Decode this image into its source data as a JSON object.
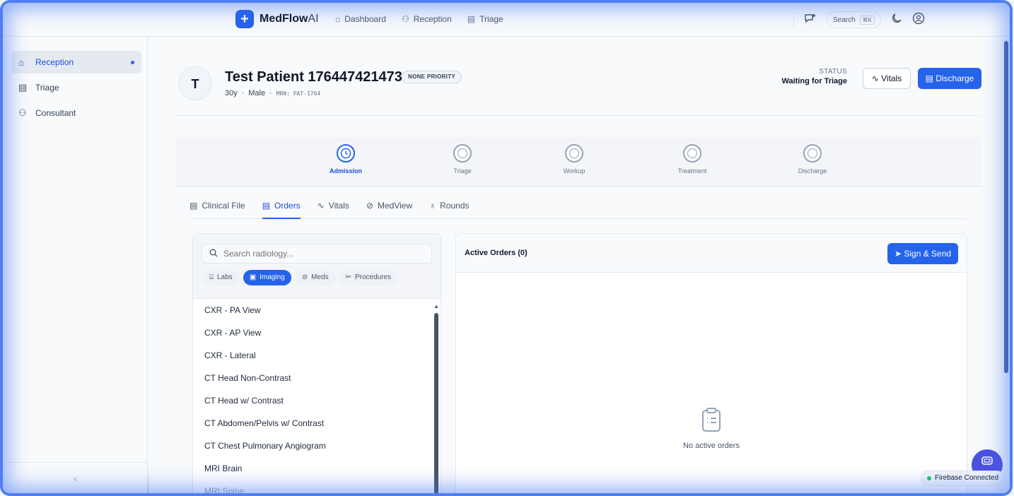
{
  "app": {
    "name_main": "MedFlow",
    "name_suffix": "AI",
    "logo_glyph": "+"
  },
  "topnav": [
    {
      "label": "Dashboard",
      "icon": "home-icon"
    },
    {
      "label": "Reception",
      "icon": "user-plus-icon"
    },
    {
      "label": "Triage",
      "icon": "clipboard-icon"
    }
  ],
  "topright": {
    "search_label": "Search",
    "search_shortcut": "⌘K"
  },
  "sidebar": {
    "items": [
      {
        "label": "Reception",
        "icon": "home-icon",
        "active": true
      },
      {
        "label": "Triage",
        "icon": "clipboard-icon",
        "active": false
      },
      {
        "label": "Consultant",
        "icon": "users-icon",
        "active": false
      }
    ],
    "collapse_glyph": "‹"
  },
  "patient": {
    "initial": "T",
    "name": "Test Patient 1764474214731",
    "priority": "NONE PRIORITY",
    "age": "30y",
    "sex": "Male",
    "mrn": "MRN: PAT-1764",
    "status_label": "STATUS",
    "status_value": "Waiting for Triage",
    "vitals_btn": "Vitals",
    "discharge_btn": "Discharge"
  },
  "stepper": [
    {
      "label": "Admission",
      "active": true
    },
    {
      "label": "Triage",
      "active": false
    },
    {
      "label": "Workup",
      "active": false
    },
    {
      "label": "Treatment",
      "active": false
    },
    {
      "label": "Discharge",
      "active": false
    }
  ],
  "tabs": [
    {
      "label": "Clinical File",
      "active": false
    },
    {
      "label": "Orders",
      "active": true
    },
    {
      "label": "Vitals",
      "active": false
    },
    {
      "label": "MedView",
      "active": false
    },
    {
      "label": "Rounds",
      "active": false
    }
  ],
  "orders": {
    "search_placeholder": "Search radiology...",
    "chips": [
      {
        "label": "Labs",
        "active": false
      },
      {
        "label": "Imaging",
        "active": true
      },
      {
        "label": "Meds",
        "active": false
      },
      {
        "label": "Procedures",
        "active": false
      }
    ],
    "items": [
      "CXR - PA View",
      "CXR - AP View",
      "CXR - Lateral",
      "CT Head Non-Contrast",
      "CT Head w/ Contrast",
      "CT Abdomen/Pelvis w/ Contrast",
      "CT Chest Pulmonary Angiogram",
      "MRI Brain",
      "MRI Spine"
    ],
    "active_title": "Active Orders (0)",
    "sign_btn": "Sign & Send",
    "empty_text": "No active orders"
  },
  "firebase": {
    "label": "Firebase Connected"
  },
  "colors": {
    "accent": "#2563eb",
    "fab": "#4c51e0",
    "connected": "#22c55e"
  }
}
